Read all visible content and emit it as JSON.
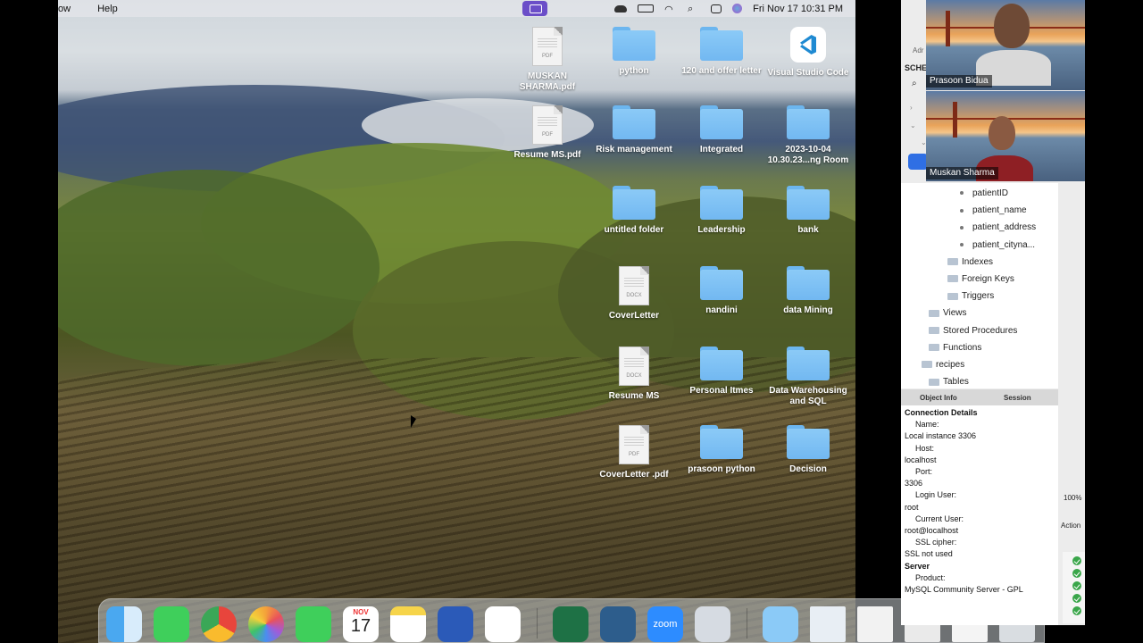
{
  "menubar": {
    "items": [
      "ow",
      "Help"
    ],
    "clock": "Fri Nov 17  10:31 PM"
  },
  "desktop_icons": [
    {
      "label": "MUSKAN SHARMA.pdf",
      "kind": "pdf"
    },
    {
      "label": "python",
      "kind": "folder"
    },
    {
      "label": "120 and offer letter",
      "kind": "folder"
    },
    {
      "label": "Visual Studio Code",
      "kind": "app"
    },
    {
      "label": "Resume MS.pdf",
      "kind": "pdf"
    },
    {
      "label": "Risk management",
      "kind": "folder"
    },
    {
      "label": "Integrated",
      "kind": "folder"
    },
    {
      "label": "2023-10-04 10.30.23...ng Room",
      "kind": "folder"
    },
    {
      "label": "untitled folder",
      "kind": "folder"
    },
    {
      "label": "Leadership",
      "kind": "folder"
    },
    {
      "label": "bank",
      "kind": "folder"
    },
    {
      "label": "CoverLetter",
      "kind": "docx"
    },
    {
      "label": "nandini",
      "kind": "folder"
    },
    {
      "label": "data Mining",
      "kind": "folder"
    },
    {
      "label": "Resume MS",
      "kind": "docx"
    },
    {
      "label": "Personal Itmes",
      "kind": "folder"
    },
    {
      "label": "Data Warehousing and SQL",
      "kind": "folder"
    },
    {
      "label": "CoverLetter .pdf",
      "kind": "pdf"
    },
    {
      "label": "prasoon python",
      "kind": "folder"
    },
    {
      "label": "Decision",
      "kind": "folder"
    }
  ],
  "doc_ext": {
    "pdf": "PDF",
    "docx": "DOCX"
  },
  "dock": {
    "calendar_month": "NOV",
    "calendar_day": "17",
    "zoom_label": "zoom"
  },
  "workbench": {
    "header_partial": "Adr",
    "schemas_partial": "SCHE",
    "tree": [
      {
        "label": "patientID",
        "type": "column"
      },
      {
        "label": "patient_name",
        "type": "column"
      },
      {
        "label": "patient_address",
        "type": "column"
      },
      {
        "label": "patient_cityna...",
        "type": "column"
      },
      {
        "label": "Indexes",
        "type": "folder"
      },
      {
        "label": "Foreign Keys",
        "type": "folder"
      },
      {
        "label": "Triggers",
        "type": "folder"
      },
      {
        "label": "Views",
        "type": "folder"
      },
      {
        "label": "Stored Procedures",
        "type": "folder"
      },
      {
        "label": "Functions",
        "type": "folder"
      },
      {
        "label": "recipes",
        "type": "schema"
      },
      {
        "label": "Tables",
        "type": "folder"
      }
    ],
    "info_tabs": [
      "Object Info",
      "Session"
    ],
    "connection": {
      "heading": "Connection Details",
      "lines": [
        {
          "text": "Name:",
          "indent": true
        },
        {
          "text": "Local instance 3306",
          "indent": false
        },
        {
          "text": "Host:",
          "indent": true
        },
        {
          "text": "localhost",
          "indent": false
        },
        {
          "text": "Port:",
          "indent": true
        },
        {
          "text": "3306",
          "indent": false
        },
        {
          "text": "Login User:",
          "indent": true
        },
        {
          "text": "root",
          "indent": false
        },
        {
          "text": "Current User:",
          "indent": true
        },
        {
          "text": "root@localhost",
          "indent": false
        },
        {
          "text": "SSL cipher:",
          "indent": true
        },
        {
          "text": "SSL not used",
          "indent": false
        }
      ],
      "server_heading": "Server",
      "server_lines": [
        {
          "text": "Product:",
          "indent": true
        },
        {
          "text": "MySQL Community Server - GPL",
          "indent": false
        }
      ]
    },
    "zoom_pct": "100%",
    "action_label": "Action"
  },
  "participants": [
    {
      "name": "Prasoon Bidua"
    },
    {
      "name": "Muskan Sharma"
    }
  ]
}
